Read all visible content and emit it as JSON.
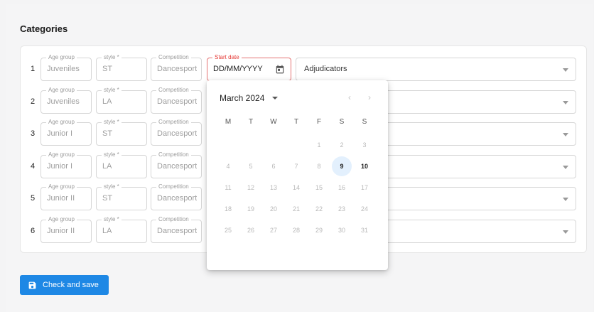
{
  "section_title": "Categories",
  "field_labels": {
    "age_group": "Age group",
    "style": "style *",
    "competition": "Competition",
    "start_date": "Start date"
  },
  "rows": [
    {
      "num": "1",
      "age_group": "Juveniles",
      "style": "ST",
      "competition": "Dancesport",
      "start_date": "DD/MM/YYYY",
      "adjudicators": "Adjudicators"
    },
    {
      "num": "2",
      "age_group": "Juveniles",
      "style": "LA",
      "competition": "Dancesport"
    },
    {
      "num": "3",
      "age_group": "Junior I",
      "style": "ST",
      "competition": "Dancesport"
    },
    {
      "num": "4",
      "age_group": "Junior I",
      "style": "LA",
      "competition": "Dancesport"
    },
    {
      "num": "5",
      "age_group": "Junior II",
      "style": "ST",
      "competition": "Dancesport"
    },
    {
      "num": "6",
      "age_group": "Junior II",
      "style": "LA",
      "competition": "Dancesport"
    }
  ],
  "calendar": {
    "month_label": "March 2024",
    "prev_icon": "‹",
    "next_icon": "›",
    "weekdays": [
      "M",
      "T",
      "W",
      "T",
      "F",
      "S",
      "S"
    ],
    "weeks": [
      [
        "",
        "",
        "",
        "",
        "1",
        "2",
        "3"
      ],
      [
        "4",
        "5",
        "6",
        "7",
        "8",
        "9",
        "10"
      ],
      [
        "11",
        "12",
        "13",
        "14",
        "15",
        "16",
        "17"
      ],
      [
        "18",
        "19",
        "20",
        "21",
        "22",
        "23",
        "24"
      ],
      [
        "25",
        "26",
        "27",
        "28",
        "29",
        "30",
        "31"
      ]
    ],
    "today": "9",
    "enabled_days": [
      "10"
    ]
  },
  "save_button": {
    "label": "Check and save",
    "icon": "save-icon"
  },
  "colors": {
    "accent": "#1e88e5",
    "error": "#e53935",
    "today_bg": "#e3f0fd"
  }
}
